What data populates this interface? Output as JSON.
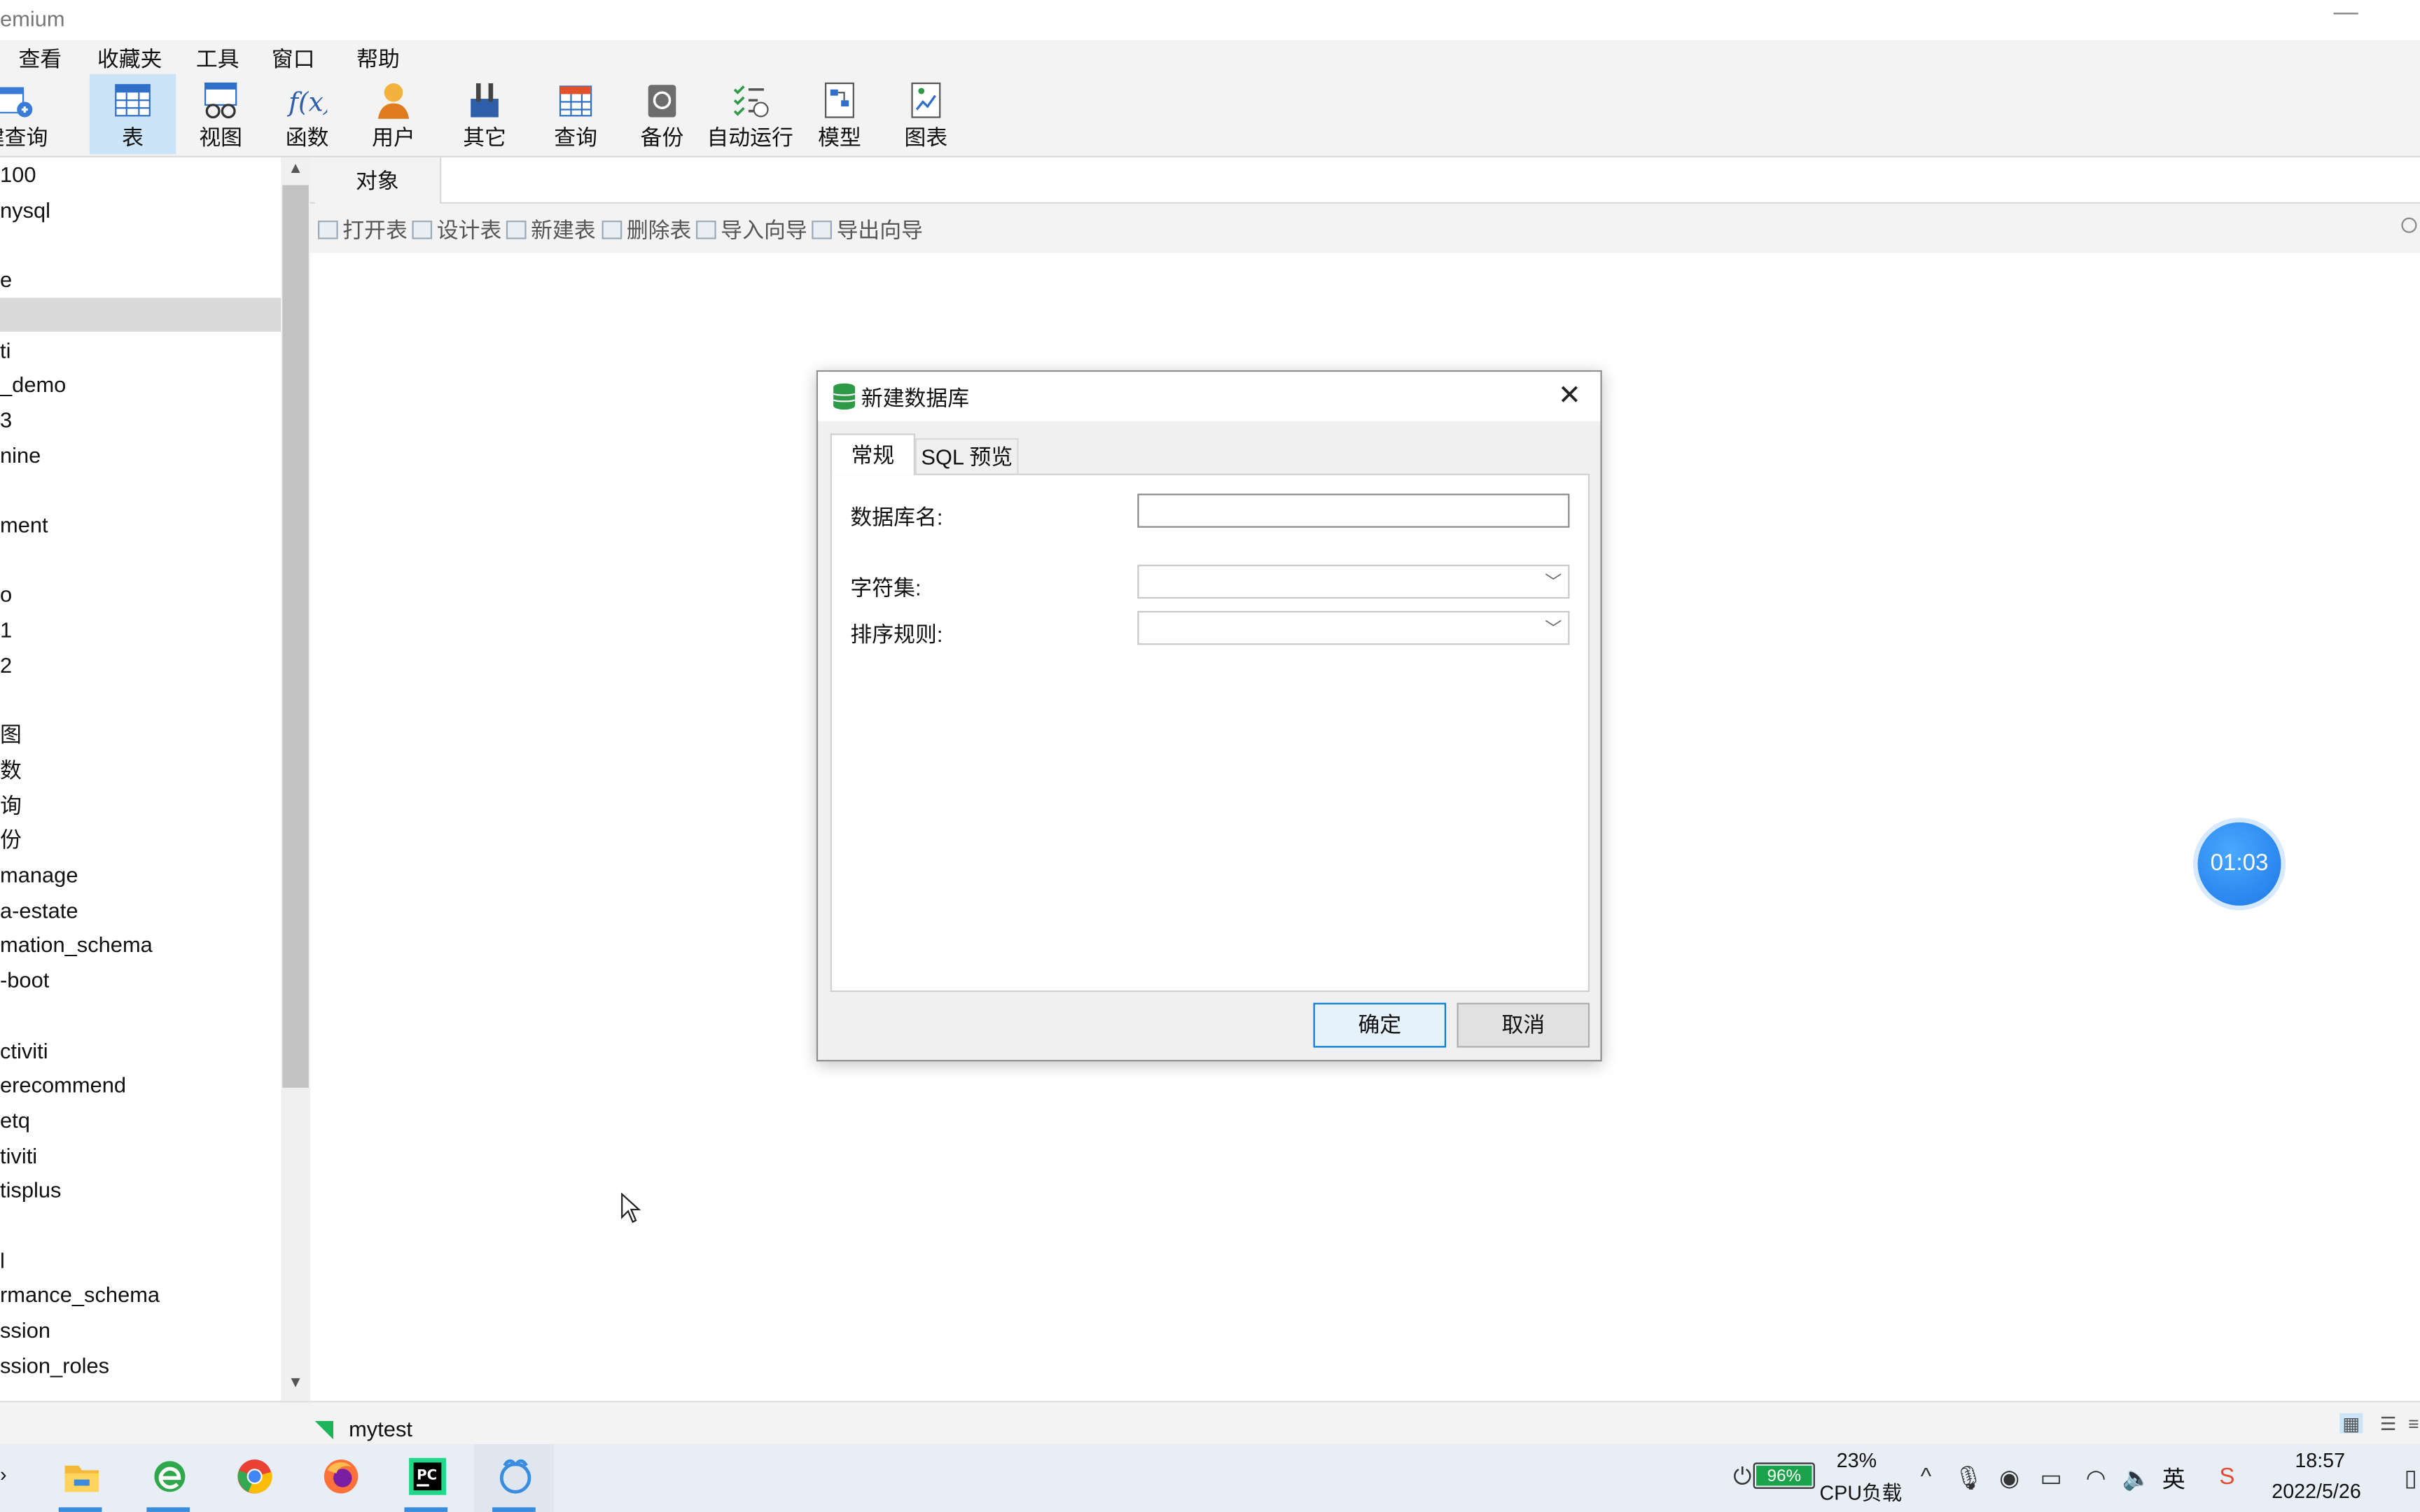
{
  "window": {
    "title": "emium"
  },
  "menu": [
    "查看",
    "收藏夹",
    "工具",
    "窗口",
    "帮助"
  ],
  "toolbar": [
    {
      "label": "建查询",
      "icon": "new-query-icon"
    },
    {
      "label": "表",
      "icon": "table-icon",
      "active": true
    },
    {
      "label": "视图",
      "icon": "view-icon"
    },
    {
      "label": "函数",
      "icon": "function-icon"
    },
    {
      "label": "用户",
      "icon": "user-icon"
    },
    {
      "label": "其它",
      "icon": "other-icon"
    },
    {
      "label": "查询",
      "icon": "query-icon"
    },
    {
      "label": "备份",
      "icon": "backup-icon"
    },
    {
      "label": "自动运行",
      "icon": "auto-run-icon"
    },
    {
      "label": "模型",
      "icon": "model-icon"
    },
    {
      "label": "图表",
      "icon": "chart-icon"
    }
  ],
  "sidebar": {
    "items": [
      "100",
      "nysql",
      "",
      "e",
      "",
      "ti",
      "_demo",
      "3",
      "nine",
      "",
      "ment",
      "",
      "o",
      "1",
      "2",
      "",
      "图",
      "数",
      "询",
      "份",
      "manage",
      "a-estate",
      "mation_schema",
      "-boot",
      "",
      "ctiviti",
      "erecommend",
      "etq",
      "tiviti",
      "tisplus",
      "",
      "l",
      "rmance_schema",
      "ssion",
      "ssion_roles"
    ],
    "selected_index": 4
  },
  "object_tab": {
    "label": "对象"
  },
  "object_toolbar": [
    "打开表",
    "设计表",
    "新建表",
    "删除表",
    "导入向导",
    "导出向导"
  ],
  "dialog": {
    "title": "新建数据库",
    "tabs": [
      "常规",
      "SQL 预览"
    ],
    "fields": {
      "db_name_label": "数据库名:",
      "db_name_value": "",
      "charset_label": "字符集:",
      "charset_value": "",
      "collation_label": "排序规则:",
      "collation_value": ""
    },
    "ok": "确定",
    "cancel": "取消"
  },
  "timer": "01:03",
  "status": {
    "connection": "mytest"
  },
  "taskbar": {
    "apps": [
      "file-explorer-icon",
      "ie-browser-icon",
      "chrome-icon",
      "firefox-icon",
      "pycharm-icon",
      "navicat-icon"
    ],
    "battery": "96%",
    "cpu_percent": "23%",
    "cpu_label": "CPU负载",
    "ime": "英",
    "time": "18:57",
    "date": "2022/5/26"
  }
}
